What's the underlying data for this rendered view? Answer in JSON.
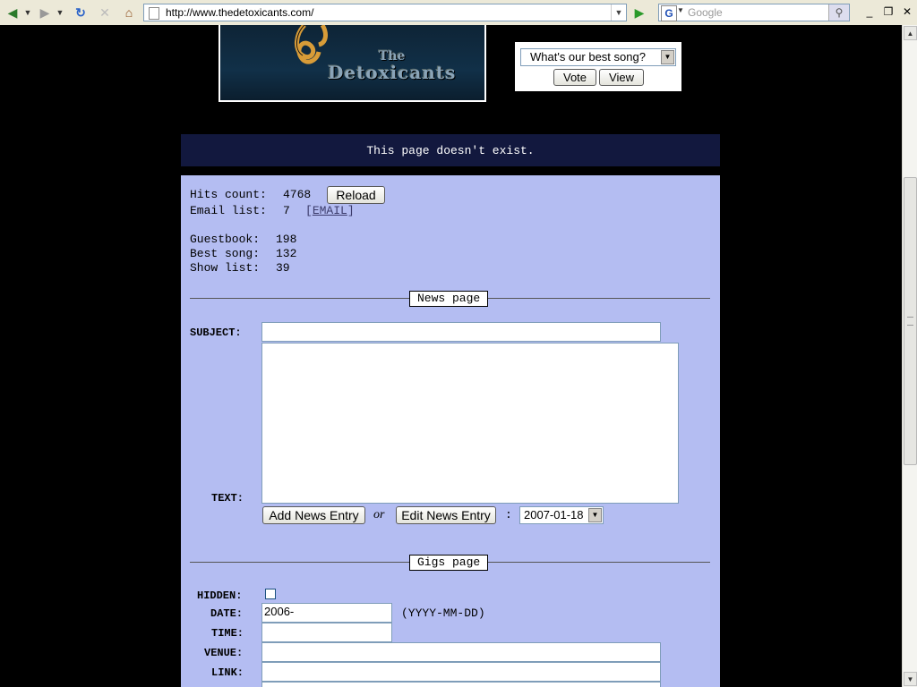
{
  "browser": {
    "url": "http://www.thedetoxicants.com/",
    "search_placeholder": "Google",
    "search_engine_letter": "G"
  },
  "logo": {
    "line1": "The",
    "line2": "Detoxicants"
  },
  "poll": {
    "selected": "What's our best song?",
    "vote_label": "Vote",
    "view_label": "View"
  },
  "banner": {
    "message": "This page doesn't exist."
  },
  "stats": {
    "hits_label": "Hits count:",
    "hits_value": "4768",
    "reload_label": "Reload",
    "email_label": "Email list:",
    "email_value": "7",
    "email_link": "EMAIL",
    "guestbook_label": "Guestbook:",
    "guestbook_value": "198",
    "bestsong_label": "Best song:",
    "bestsong_value": "132",
    "showlist_label": "Show list:",
    "showlist_value": "39"
  },
  "news": {
    "legend": "News page",
    "subject_label": "SUBJECT:",
    "text_label": "TEXT:",
    "add_label": "Add News Entry",
    "or_label": "or",
    "edit_label": "Edit News Entry",
    "colon": ":",
    "date_selected": "2007-01-18"
  },
  "gigs": {
    "legend": "Gigs page",
    "hidden_label": "HIDDEN:",
    "date_label": "DATE:",
    "date_value": "2006-",
    "date_hint": "(YYYY-MM-DD)",
    "time_label": "TIME:",
    "venue_label": "VENUE:",
    "link_label": "LINK:"
  }
}
